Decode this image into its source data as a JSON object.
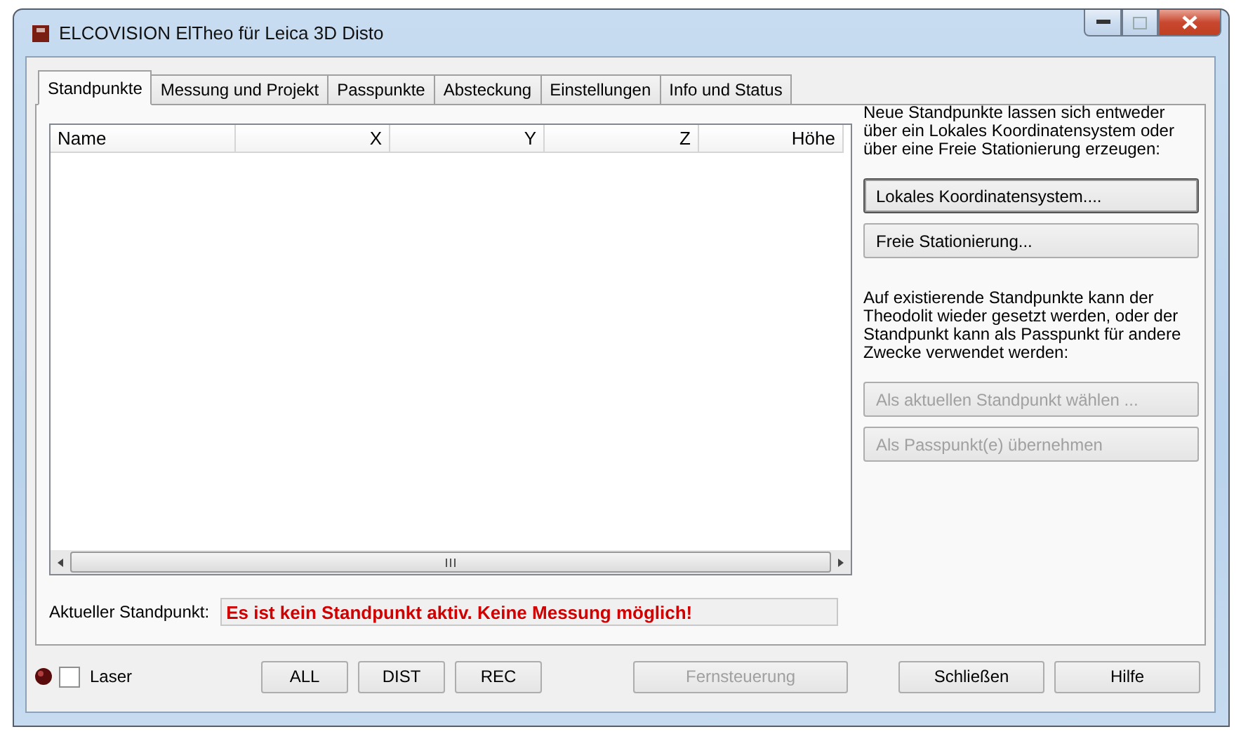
{
  "window": {
    "title": "ELCOVISION ElTheo für Leica 3D Disto"
  },
  "tabs": [
    {
      "label": "Standpunkte",
      "selected": true
    },
    {
      "label": "Messung und Projekt",
      "selected": false
    },
    {
      "label": "Passpunkte",
      "selected": false
    },
    {
      "label": "Absteckung",
      "selected": false
    },
    {
      "label": "Einstellungen",
      "selected": false
    },
    {
      "label": "Info und Status",
      "selected": false
    }
  ],
  "table": {
    "columns": [
      "Name",
      "X",
      "Y",
      "Z",
      "Höhe"
    ]
  },
  "side_panel": {
    "intro": "Neue Standpunkte lassen sich entweder über ein Lokales Koordinatensystem oder über eine Freie Stationierung erzeugen:",
    "create_buttons": [
      {
        "label": "Lokales Koordinatensystem....",
        "disabled": false,
        "default": true
      },
      {
        "label": "Freie Stationierung...",
        "disabled": false,
        "default": false
      }
    ],
    "info": "Auf existierende Standpunkte kann der Theodolit wieder gesetzt werden, oder der Standpunkt kann als Passpunkt für andere Zwecke verwendet werden:",
    "action_buttons": [
      {
        "label": "Als aktuellen Standpunkt wählen ...",
        "disabled": true
      },
      {
        "label": "Als Passpunkt(e) übernehmen",
        "disabled": true
      }
    ]
  },
  "status": {
    "label": "Aktueller Standpunkt:",
    "value": "Es ist kein Standpunkt aktiv. Keine Messung möglich!"
  },
  "bottom_bar": {
    "laser": {
      "label": "Laser",
      "checked": false
    },
    "buttons": [
      {
        "label": "ALL",
        "disabled": false
      },
      {
        "label": "DIST",
        "disabled": false
      },
      {
        "label": "REC",
        "disabled": false
      }
    ],
    "remote": {
      "label": "Fernsteuerung",
      "disabled": true
    },
    "right_buttons": [
      {
        "label": "Schließen",
        "disabled": false
      },
      {
        "label": "Hilfe",
        "disabled": false
      }
    ]
  }
}
